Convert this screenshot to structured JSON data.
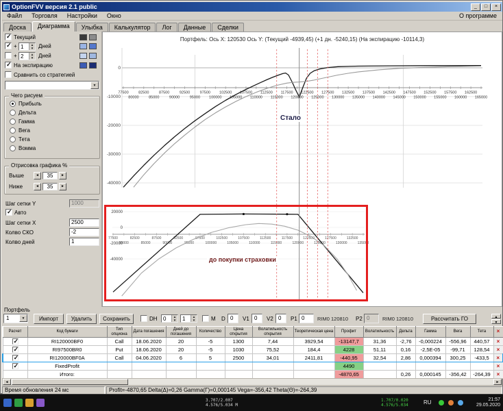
{
  "icons": {
    "dropdown_arrow": "▼",
    "spin_up": "▲",
    "spin_down": "▼",
    "spin_left": "◄",
    "spin_right": "►",
    "delete_x": "×",
    "minimize": "_",
    "maximize": "□",
    "close": "×"
  },
  "window": {
    "title": "OptionFVV версия 2.1 public"
  },
  "menu": {
    "items": [
      "Файл",
      "Торговля",
      "Настройки",
      "Окно"
    ],
    "right": "О программе"
  },
  "tabs": {
    "items": [
      "Доска",
      "Диаграмма",
      "Улыбка",
      "Калькулятор",
      "Лог",
      "Данные",
      "Сделки"
    ],
    "active": "Диаграмма"
  },
  "left_panel": {
    "curves": [
      {
        "label": "Текущий",
        "checked": true,
        "color1": "#3a3a3a",
        "color2": "#8c8c8c"
      },
      {
        "prefix": "+",
        "days": "1",
        "label": "Дней",
        "checked": true,
        "color1": "#9ab4e4",
        "color2": "#5578cc"
      },
      {
        "prefix": "+",
        "days": "2",
        "label": "Дней",
        "checked": false,
        "color1": "#c4d4ee",
        "color2": "#a0b8e0"
      },
      {
        "label": "На экспирацию",
        "checked": true,
        "color1": "#3c5cb4",
        "color2": "#1a2c74"
      }
    ],
    "compare": {
      "label": "Сравнить со стратегией",
      "checked": false
    },
    "draw_group": {
      "title": "Чего рисуем",
      "selected": "Прибыль",
      "options": [
        "Прибыль",
        "Дельта",
        "Гамма",
        "Вега",
        "Тета",
        "Вомма"
      ]
    },
    "render_group": {
      "title": "Отрисовка графика %",
      "rows": [
        {
          "label": "Выше",
          "value": "35"
        },
        {
          "label": "Ниже",
          "value": "35"
        }
      ]
    },
    "grid_y": {
      "label": "Шаг сетки Y",
      "value": "1000",
      "disabled": true
    },
    "auto": {
      "label": "Авто",
      "checked": true
    },
    "grid_x": {
      "label": "Шаг сетки X",
      "value": "2500"
    },
    "sko": {
      "label": "Колво СКО",
      "value": "-2"
    },
    "days": {
      "label": "Колво дней",
      "value": "1"
    }
  },
  "chart": {
    "header": "Портфель:  Ось X: 120530  Ось Y:  (Текущий -4939,45)  (+1 дн. -5240,15)  (На экспирацию -10114,3)",
    "main": {
      "label": "Стало",
      "x_min": 77500,
      "x_max": 165000,
      "x_step": 2500,
      "y_ticks": [
        0,
        -10000,
        -20000,
        -30000,
        -40000
      ],
      "current_x": 120530,
      "sd_lines": [
        95000,
        146000
      ],
      "red_lines": [
        115000,
        122500,
        125000,
        127500
      ],
      "markers": [
        [
          120530,
          -10114
        ]
      ],
      "series": [
        {
          "name": "На экспирацию",
          "color": "#1a1a1a",
          "width": 1.3,
          "points": [
            [
              77500,
              -41500
            ],
            [
              80000,
              -37600
            ],
            [
              82500,
              -33900
            ],
            [
              85000,
              -30400
            ],
            [
              87500,
              -27100
            ],
            [
              90000,
              -24000
            ],
            [
              92500,
              -21100
            ],
            [
              95000,
              -18400
            ],
            [
              97500,
              -15900
            ],
            [
              100000,
              -13500
            ],
            [
              102500,
              -11300
            ],
            [
              105000,
              -9300
            ],
            [
              107500,
              -7500
            ],
            [
              110000,
              -5800
            ],
            [
              112500,
              -4200
            ],
            [
              114000,
              -3300
            ],
            [
              115500,
              -2500
            ],
            [
              116500,
              -2000
            ],
            [
              117200,
              -1800
            ],
            [
              117900,
              -2500
            ],
            [
              118800,
              -5000
            ],
            [
              119700,
              -7800
            ],
            [
              120530,
              -10114
            ],
            [
              121400,
              -6800
            ],
            [
              122300,
              -3600
            ],
            [
              123200,
              -1900
            ],
            [
              124200,
              -1000
            ],
            [
              125500,
              -400
            ],
            [
              127500,
              100
            ],
            [
              130000,
              400
            ],
            [
              135000,
              600
            ],
            [
              142500,
              700
            ],
            [
              152500,
              750
            ],
            [
              165000,
              780
            ]
          ]
        },
        {
          "name": "Текущий",
          "color": "#9a9a9a",
          "width": 1.1,
          "points": [
            [
              80000,
              -41500
            ],
            [
              82500,
              -37200
            ],
            [
              85000,
              -33300
            ],
            [
              87500,
              -29700
            ],
            [
              90000,
              -26400
            ],
            [
              92500,
              -23400
            ],
            [
              95000,
              -20600
            ],
            [
              97500,
              -18000
            ],
            [
              100000,
              -15700
            ],
            [
              102500,
              -13600
            ],
            [
              105000,
              -11700
            ],
            [
              107500,
              -10000
            ],
            [
              110000,
              -8500
            ],
            [
              112500,
              -7200
            ],
            [
              115000,
              -6100
            ],
            [
              117500,
              -5300
            ],
            [
              119000,
              -5050
            ],
            [
              120530,
              -4939
            ],
            [
              122000,
              -4750
            ],
            [
              124000,
              -4300
            ],
            [
              126000,
              -3700
            ],
            [
              128000,
              -3100
            ],
            [
              130000,
              -2500
            ],
            [
              132500,
              -1900
            ],
            [
              135000,
              -1400
            ],
            [
              140000,
              -700
            ],
            [
              145000,
              -200
            ],
            [
              150000,
              100
            ],
            [
              157500,
              400
            ],
            [
              165000,
              600
            ]
          ]
        }
      ]
    },
    "inset": {
      "label": "до покупки страховки",
      "x_min": 77500,
      "x_max": 135000,
      "x_step": 2500,
      "y_ticks": [
        20000,
        0,
        -20000,
        -40000
      ],
      "markers": [
        [
          107500,
          17000
        ],
        [
          117500,
          16800
        ]
      ],
      "series": [
        {
          "name": "На экспирацию",
          "color": "#1a1a1a",
          "width": 1.3,
          "points": [
            [
              77500,
              -82000
            ],
            [
              97500,
              16650
            ],
            [
              107500,
              17000
            ],
            [
              117500,
              16800
            ],
            [
              120000,
              16650
            ],
            [
              135000,
              -83000
            ]
          ]
        },
        {
          "name": "Текущий",
          "color": "#a8a8a8",
          "width": 1.1,
          "points": [
            [
              79500,
              -87000
            ],
            [
              84000,
              -58000
            ],
            [
              88000,
              -40000
            ],
            [
              92000,
              -26000
            ],
            [
              96000,
              -15000
            ],
            [
              100000,
              -6500
            ],
            [
              104000,
              -500
            ],
            [
              108000,
              3500
            ],
            [
              111000,
              5000
            ],
            [
              114000,
              4200
            ],
            [
              117000,
              1500
            ],
            [
              120000,
              -3500
            ],
            [
              123000,
              -11500
            ],
            [
              126000,
              -23000
            ],
            [
              129000,
              -40000
            ],
            [
              131500,
              -60000
            ],
            [
              133500,
              -80000
            ]
          ]
        }
      ]
    }
  },
  "portfolio": {
    "section_label": "Портфель",
    "toolbar": {
      "preset": "1",
      "import_btn": "Импорт",
      "delete_btn": "Удалить",
      "save_btn": "Сохранить",
      "dh": {
        "label": "DH",
        "checked": false,
        "spin1": "0",
        "spin2": "1"
      },
      "m": {
        "label": "М",
        "checked": false
      },
      "fields": [
        {
          "label": "D",
          "value": "0"
        },
        {
          "label": "V1",
          "value": "0"
        },
        {
          "label": "V2",
          "value": "0"
        },
        {
          "label": "P1",
          "value": "0"
        }
      ],
      "rim1": "RIM0 120810",
      "p2": {
        "label": "P2",
        "value": "0"
      },
      "rim2": "RIM0 120810",
      "calc_btn": "Рассчитать ГО"
    },
    "table": {
      "columns": [
        "Расчет",
        "Код бумаги",
        "Тип опциона",
        "Дата погашения",
        "Дней до погашения",
        "Количество",
        "Цена открытия",
        "Волатильность открытия",
        "Теоретическая цена",
        "Профит",
        "Волатильность",
        "Дельта",
        "Гамма",
        "Вега",
        "Тета"
      ],
      "rows": [
        {
          "check": true,
          "highlight": false,
          "profit_state": "neg",
          "cells": [
            "RI120000BF0",
            "Call",
            "18.06.2020",
            "20",
            "-5",
            "1300",
            "7,44",
            "3929,54",
            "-13147,7",
            "31,36",
            "-2,76",
            "-0,000224",
            "-556,96",
            "440,57"
          ]
        },
        {
          "check": true,
          "highlight": false,
          "profit_state": "pos",
          "cells": [
            "RI97500BR0",
            "Put",
            "18.06.2020",
            "20",
            "-5",
            "1030",
            "75,52",
            "184,4",
            "4228",
            "51,11",
            "0,16",
            "-2,5E-05",
            "-99,71",
            "128,54"
          ]
        },
        {
          "check": true,
          "highlight": true,
          "profit_state": "neg",
          "cells": [
            "RI120000BF0A",
            "Call",
            "04.06.2020",
            "6",
            "5",
            "2500",
            "34,01",
            "2411,81",
            "-440,95",
            "32,54",
            "2,86",
            "0,000394",
            "300,25",
            "-433,5"
          ]
        },
        {
          "check": true,
          "highlight": false,
          "profit_state": "pos",
          "cells": [
            "FixedProfit",
            "",
            "",
            "",
            "",
            "",
            "",
            "",
            "4490",
            "",
            "",
            "",
            "",
            ""
          ]
        },
        {
          "check": null,
          "highlight": false,
          "profit_state": "neg",
          "cells": [
            "Итого:",
            "",
            "",
            "",
            "",
            "",
            "",
            "",
            "-4870,65",
            "",
            "0,26",
            "0,000145",
            "-356,42",
            "-264,39"
          ]
        }
      ]
    }
  },
  "status_bar": {
    "left": "Время обновления 24 мс",
    "metrics": "Profit=-4870,65 Delta(Δ)=0,26 Gamma(Γ)=0,000145 Vega=-356,42 Theta(Θ)=-264,39"
  },
  "taskbar": {
    "net_a1": "3.707/2.007",
    "net_a2": "4.576/5.034 М",
    "net_b1": "1.707/0.020",
    "net_b2": "4.576/5.034",
    "lang": "RU",
    "time": "21:57",
    "date": "29.05.2020"
  }
}
